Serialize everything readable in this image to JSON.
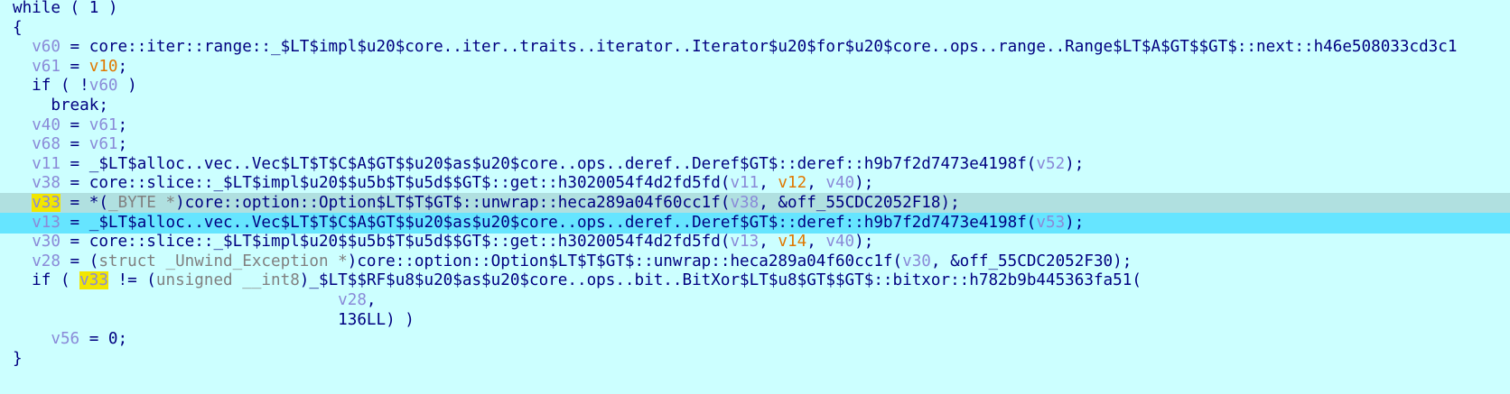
{
  "window": {
    "title": ""
  },
  "editor": {
    "lines": [
      [
        {
          "t": "while ( 1 )",
          "c": ""
        }
      ],
      [
        {
          "t": "{",
          "c": ""
        }
      ],
      [
        {
          "t": "  ",
          "c": ""
        },
        {
          "t": "v60",
          "c": "v"
        },
        {
          "t": " = core::iter::range::_$LT$impl$u20$core..iter..traits..iterator..Iterator$u20$for$u20$core..ops..range..Range$LT$A$GT$$GT$::next::h46e508033cd3c1",
          "c": ""
        }
      ],
      [
        {
          "t": "  ",
          "c": ""
        },
        {
          "t": "v61",
          "c": "v"
        },
        {
          "t": " = ",
          "c": ""
        },
        {
          "t": "v10",
          "c": "g"
        },
        {
          "t": ";",
          "c": ""
        }
      ],
      [
        {
          "t": "  if ( !",
          "c": ""
        },
        {
          "t": "v60",
          "c": "v"
        },
        {
          "t": " )",
          "c": ""
        }
      ],
      [
        {
          "t": "    break;",
          "c": ""
        }
      ],
      [
        {
          "t": "  ",
          "c": ""
        },
        {
          "t": "v40",
          "c": "v"
        },
        {
          "t": " = ",
          "c": ""
        },
        {
          "t": "v61",
          "c": "v"
        },
        {
          "t": ";",
          "c": ""
        }
      ],
      [
        {
          "t": "  ",
          "c": ""
        },
        {
          "t": "v68",
          "c": "v"
        },
        {
          "t": " = ",
          "c": ""
        },
        {
          "t": "v61",
          "c": "v"
        },
        {
          "t": ";",
          "c": ""
        }
      ],
      [
        {
          "t": "  ",
          "c": ""
        },
        {
          "t": "v11",
          "c": "v"
        },
        {
          "t": " = _$LT$alloc..vec..Vec$LT$T$C$A$GT$$u20$as$u20$core..ops..deref..Deref$GT$::deref::h9b7f2d7473e4198f(",
          "c": ""
        },
        {
          "t": "v52",
          "c": "v"
        },
        {
          "t": ");",
          "c": ""
        }
      ],
      [
        {
          "t": "  ",
          "c": ""
        },
        {
          "t": "v38",
          "c": "v"
        },
        {
          "t": " = core::slice::_$LT$impl$u20$$u5b$T$u5d$$GT$::get::h3020054f4d2fd5fd(",
          "c": ""
        },
        {
          "t": "v11",
          "c": "v"
        },
        {
          "t": ", ",
          "c": ""
        },
        {
          "t": "v12",
          "c": "g"
        },
        {
          "t": ", ",
          "c": ""
        },
        {
          "t": "v40",
          "c": "v"
        },
        {
          "t": ");",
          "c": ""
        }
      ],
      [
        {
          "t": "  ",
          "c": ""
        },
        {
          "t": "v33",
          "c": "mark"
        },
        {
          "t": " = *(",
          "c": ""
        },
        {
          "t": "_BYTE *",
          "c": "t"
        },
        {
          "t": ")core::option::Option$LT$T$GT$::unwrap::heca289a04f60cc1f(",
          "c": ""
        },
        {
          "t": "v38",
          "c": "v"
        },
        {
          "t": ", &off_55CDC2052F18);",
          "c": ""
        }
      ],
      [
        {
          "t": "  ",
          "c": ""
        },
        {
          "t": "v13",
          "c": "v"
        },
        {
          "t": " = _$LT$alloc..vec..Vec$LT$T$C$A$GT$$u20$as$u20$core..ops..deref..Deref$GT$::deref::h9b7f2d7473e4198f(",
          "c": ""
        },
        {
          "t": "v53",
          "c": "v"
        },
        {
          "t": ");",
          "c": ""
        }
      ],
      [
        {
          "t": "  ",
          "c": ""
        },
        {
          "t": "v30",
          "c": "v"
        },
        {
          "t": " = core::slice::_$LT$impl$u20$$u5b$T$u5d$$GT$::get::h3020054f4d2fd5fd(",
          "c": ""
        },
        {
          "t": "v13",
          "c": "v"
        },
        {
          "t": ", ",
          "c": ""
        },
        {
          "t": "v14",
          "c": "g"
        },
        {
          "t": ", ",
          "c": ""
        },
        {
          "t": "v40",
          "c": "v"
        },
        {
          "t": ");",
          "c": ""
        }
      ],
      [
        {
          "t": "  ",
          "c": ""
        },
        {
          "t": "v28",
          "c": "v"
        },
        {
          "t": " = (",
          "c": ""
        },
        {
          "t": "struct _Unwind_Exception *",
          "c": "t"
        },
        {
          "t": ")core::option::Option$LT$T$GT$::unwrap::heca289a04f60cc1f(",
          "c": ""
        },
        {
          "t": "v30",
          "c": "v"
        },
        {
          "t": ", &off_55CDC2052F30);",
          "c": ""
        }
      ],
      [
        {
          "t": "  if ( ",
          "c": ""
        },
        {
          "t": "v33",
          "c": "mark"
        },
        {
          "t": " != (",
          "c": ""
        },
        {
          "t": "unsigned __int8",
          "c": "t"
        },
        {
          "t": ")_$LT$$RF$u8$u20$as$u20$core..ops..bit..BitXor$LT$u8$GT$$GT$::bitxor::h782b9b445363fa51(",
          "c": ""
        }
      ],
      [
        {
          "t": "                                  ",
          "c": ""
        },
        {
          "t": "v28",
          "c": "v"
        },
        {
          "t": ",",
          "c": ""
        }
      ],
      [
        {
          "t": "                                  136LL) )",
          "c": ""
        }
      ],
      [
        {
          "t": "    ",
          "c": ""
        },
        {
          "t": "v56",
          "c": "v"
        },
        {
          "t": " = 0;",
          "c": ""
        }
      ],
      [
        {
          "t": "}",
          "c": ""
        }
      ]
    ],
    "current_line": 10,
    "selected_line": 11
  },
  "colors": {
    "background": "#ccffff",
    "text": "#000080",
    "variable": "#8a8ad8",
    "global": "#e07800",
    "type": "#808080",
    "search_mark": "#f2e600",
    "current_line_bg": "#b0e0e0",
    "selected_line_bg": "#66e5ff"
  }
}
